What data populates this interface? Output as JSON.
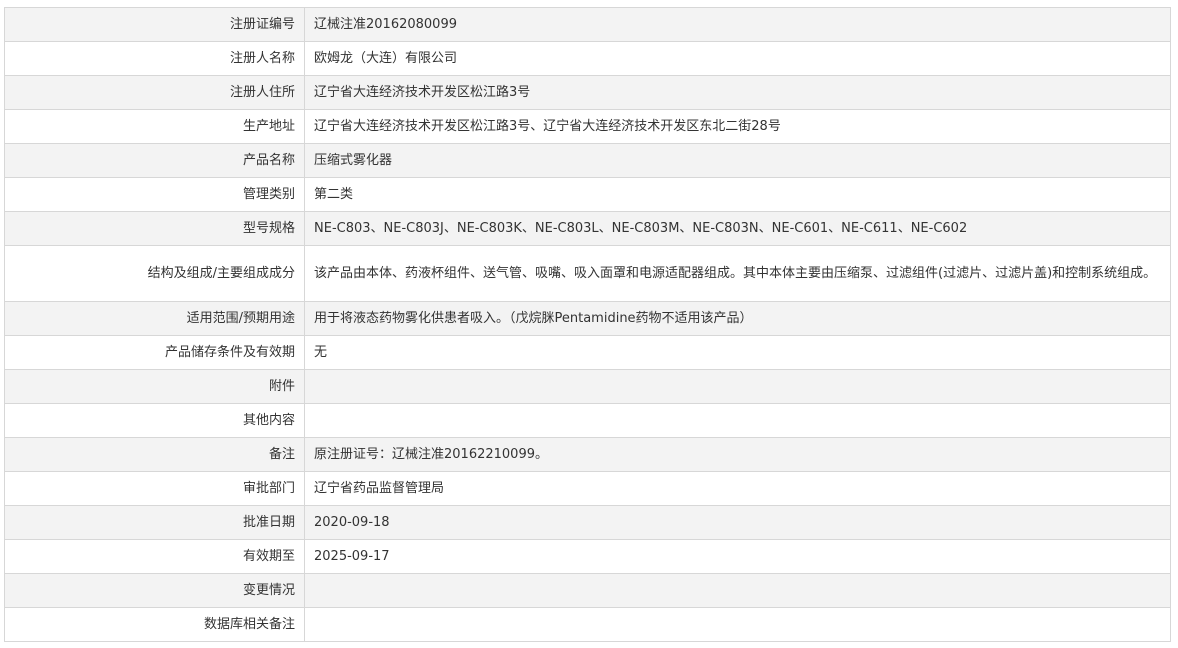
{
  "rows": [
    {
      "label": "注册证编号",
      "value": "辽械注准20162080099"
    },
    {
      "label": "注册人名称",
      "value": "欧姆龙（大连）有限公司"
    },
    {
      "label": "注册人住所",
      "value": "辽宁省大连经济技术开发区松江路3号"
    },
    {
      "label": "生产地址",
      "value": "辽宁省大连经济技术开发区松江路3号、辽宁省大连经济技术开发区东北二街28号"
    },
    {
      "label": "产品名称",
      "value": "压缩式雾化器"
    },
    {
      "label": "管理类别",
      "value": "第二类"
    },
    {
      "label": "型号规格",
      "value": "NE-C803、NE-C803J、NE-C803K、NE-C803L、NE-C803M、NE-C803N、NE-C601、NE-C611、NE-C602"
    },
    {
      "label": "结构及组成/主要组成成分",
      "value": "该产品由本体、药液杯组件、送气管、吸嘴、吸入面罩和电源适配器组成。其中本体主要由压缩泵、过滤组件(过滤片、过滤片盖)和控制系统组成。"
    },
    {
      "label": "适用范围/预期用途",
      "value": "用于将液态药物雾化供患者吸入。（戊烷脒Pentamidine药物不适用该产品）"
    },
    {
      "label": "产品储存条件及有效期",
      "value": "无"
    },
    {
      "label": "附件",
      "value": ""
    },
    {
      "label": "其他内容",
      "value": ""
    },
    {
      "label": "备注",
      "value": "原注册证号：辽械注准20162210099。"
    },
    {
      "label": "审批部门",
      "value": "辽宁省药品监督管理局"
    },
    {
      "label": "批准日期",
      "value": "2020-09-18"
    },
    {
      "label": "有效期至",
      "value": "2025-09-17"
    },
    {
      "label": "变更情况",
      "value": ""
    },
    {
      "label": "数据库相关备注",
      "value": ""
    }
  ]
}
